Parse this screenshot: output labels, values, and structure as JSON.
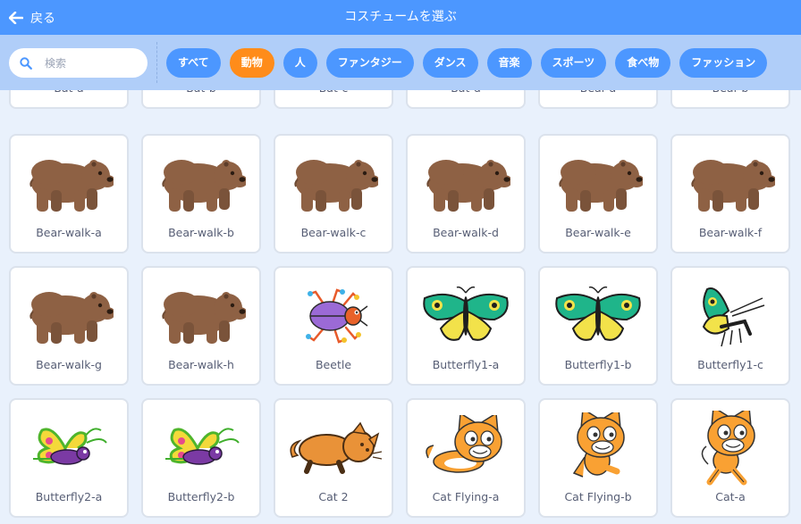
{
  "header": {
    "back_label": "戻る",
    "title": "コスチュームを選ぶ"
  },
  "search": {
    "placeholder": "検索",
    "value": ""
  },
  "tags": [
    {
      "label": "すべて",
      "active": false
    },
    {
      "label": "動物",
      "active": true
    },
    {
      "label": "人",
      "active": false
    },
    {
      "label": "ファンタジー",
      "active": false
    },
    {
      "label": "ダンス",
      "active": false
    },
    {
      "label": "音楽",
      "active": false
    },
    {
      "label": "スポーツ",
      "active": false
    },
    {
      "label": "食べ物",
      "active": false
    },
    {
      "label": "ファッション",
      "active": false
    }
  ],
  "costumes": [
    {
      "name": "Bat-a",
      "icon": ""
    },
    {
      "name": "Bat-b",
      "icon": ""
    },
    {
      "name": "Bat-c",
      "icon": ""
    },
    {
      "name": "Bat-d",
      "icon": ""
    },
    {
      "name": "Bear-a",
      "icon": ""
    },
    {
      "name": "Bear-b",
      "icon": ""
    },
    {
      "name": "Bear-walk-a",
      "icon": "bear"
    },
    {
      "name": "Bear-walk-b",
      "icon": "bear"
    },
    {
      "name": "Bear-walk-c",
      "icon": "bear"
    },
    {
      "name": "Bear-walk-d",
      "icon": "bear"
    },
    {
      "name": "Bear-walk-e",
      "icon": "bear"
    },
    {
      "name": "Bear-walk-f",
      "icon": "bear"
    },
    {
      "name": "Bear-walk-g",
      "icon": "bear"
    },
    {
      "name": "Bear-walk-h",
      "icon": "bear"
    },
    {
      "name": "Beetle",
      "icon": "beetle"
    },
    {
      "name": "Butterfly1-a",
      "icon": "butterfly1"
    },
    {
      "name": "Butterfly1-b",
      "icon": "butterfly1"
    },
    {
      "name": "Butterfly1-c",
      "icon": "butterfly1-side"
    },
    {
      "name": "Butterfly2-a",
      "icon": "butterfly2"
    },
    {
      "name": "Butterfly2-b",
      "icon": "butterfly2"
    },
    {
      "name": "Cat 2",
      "icon": "cat-lying"
    },
    {
      "name": "Cat Flying-a",
      "icon": "cat-flying"
    },
    {
      "name": "Cat Flying-b",
      "icon": "cat-flying2"
    },
    {
      "name": "Cat-a",
      "icon": "cat"
    }
  ],
  "colors": {
    "header": "#4c97ff",
    "filterbar": "#b0cef9",
    "tag": "#4c97ff",
    "tag_active": "#ff8c1a",
    "background": "#e9f1fc",
    "bear": "#8e6144",
    "cat": "#f9a133"
  }
}
